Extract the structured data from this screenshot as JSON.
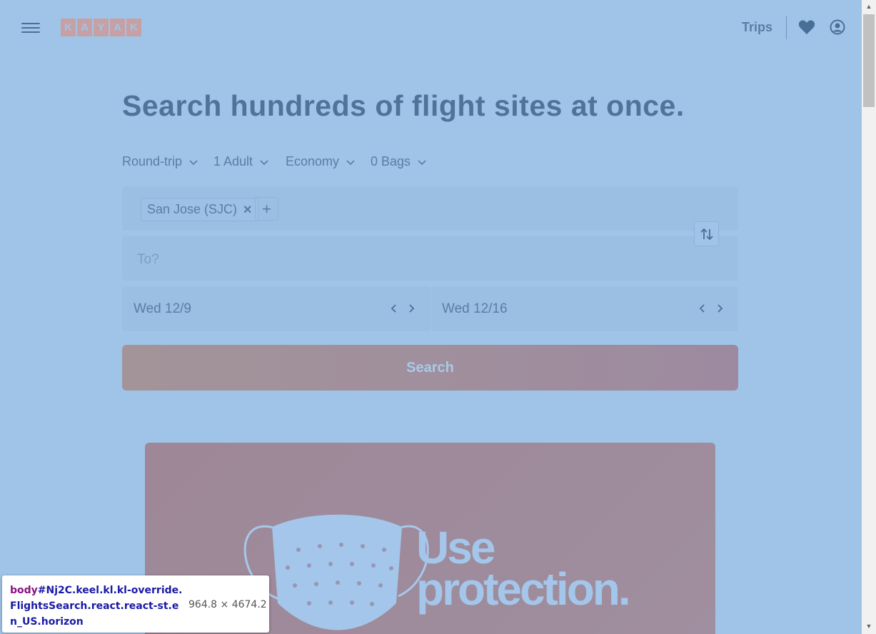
{
  "header": {
    "logo_letters": [
      "K",
      "A",
      "Y",
      "A",
      "K"
    ],
    "trips_label": "Trips",
    "heart_icon": "heart-icon",
    "user_icon": "user-circle-icon",
    "menu_icon": "hamburger-menu-icon"
  },
  "headline": "Search hundreds of flight sites at once.",
  "options": {
    "trip_type": "Round-trip",
    "travelers": "1 Adult",
    "cabin": "Economy",
    "bags": "0 Bags"
  },
  "origin": {
    "chip_label": "San Jose (SJC)",
    "remove_glyph": "✕",
    "add_glyph": "+"
  },
  "destination": {
    "placeholder": "To?"
  },
  "dates": {
    "depart": "Wed 12/9",
    "return": "Wed 12/16"
  },
  "search_label": "Search",
  "promo": {
    "line1": "Use",
    "line2": "protection."
  },
  "devtools_tooltip": {
    "tag": "body",
    "selector": "#Nj2C.keel.kl.kl-override.FlightsSearch.react.react-st.en_US.horizon",
    "dimensions": "964.8 × 4674.2"
  },
  "colors": {
    "background": "#a0c4e8",
    "text": "#4a6f96",
    "search_button": "#9f8f9e",
    "logo": "#c7a0a3"
  }
}
